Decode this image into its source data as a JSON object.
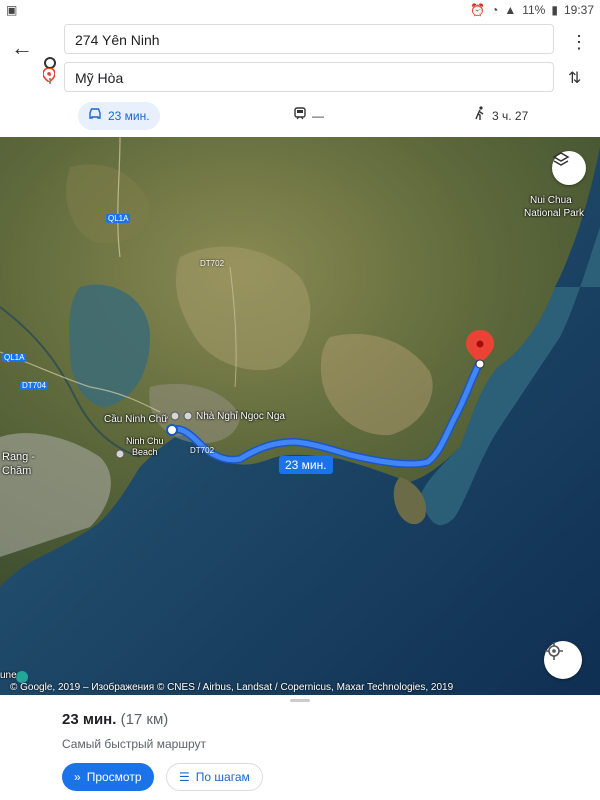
{
  "status": {
    "battery": "11%",
    "time": "19:37"
  },
  "route": {
    "origin": "274 Yên Ninh",
    "destination": "Mỹ Hòa"
  },
  "modes": [
    {
      "label": "23 мин.",
      "icon": "car-icon",
      "active": true
    },
    {
      "label": "—",
      "icon": "train-icon",
      "active": false
    },
    {
      "label": "3 ч. 27",
      "icon": "walk-icon",
      "active": false
    }
  ],
  "map": {
    "labels": {
      "park": "Nui Chua\nNational Park",
      "nui_chua_1": "Nui Chua",
      "nui_chua_2": "National Park",
      "cau_ninh_chu": "Cầu Ninh Chữ",
      "nha_nghi": "Nhà Nghỉ Ngọc Nga",
      "ninh_chu_beach_1": "Ninh Chu",
      "ninh_chu_beach_2": "Beach",
      "rang_cham_1": "Rang -",
      "rang_cham_2": "Chăm",
      "une": "une"
    },
    "roads": {
      "ql1a_1": "QL1A",
      "ql1a_2": "QL1A",
      "dt702_1": "DT702",
      "dt702_2": "DT702",
      "dt704": "DT704"
    },
    "route_time": "23 мин.",
    "credits": "© Google, 2019 – Изображения © CNES / Airbus, Landsat / Copernicus, Maxar Technologies, 2019",
    "colors": {
      "route": "#4285f4",
      "route_border": "#1a56c4",
      "pin": "#ea4335"
    }
  },
  "sheet": {
    "duration": "23 мин.",
    "distance": "(17 км)",
    "subtitle": "Самый быстрый маршрут",
    "preview_button": "Просмотр",
    "steps_button": "По шагам"
  }
}
